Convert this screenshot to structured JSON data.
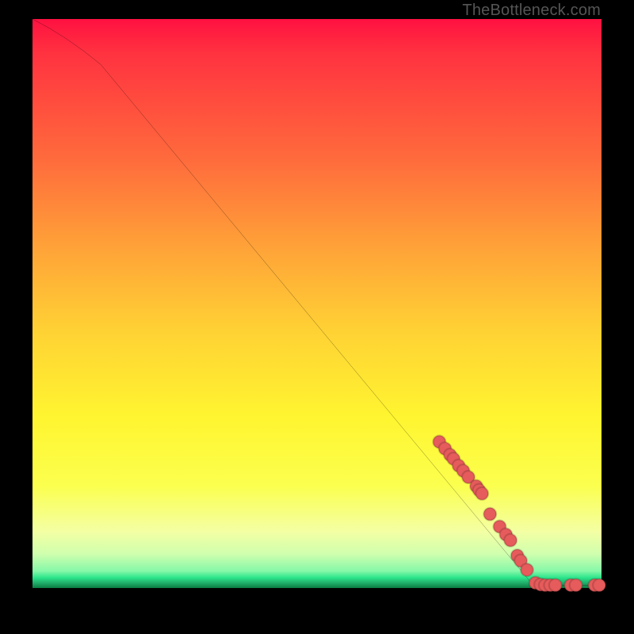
{
  "watermark": "TheBottleneck.com",
  "colors": {
    "background": "#000000",
    "dot": "#e65b5b",
    "curve": "#000000"
  },
  "chart_data": {
    "type": "line",
    "title": "",
    "xlabel": "",
    "ylabel": "",
    "xlim": [
      0,
      100
    ],
    "ylim": [
      0,
      100
    ],
    "grid": false,
    "series": [
      {
        "name": "bottleneck-curve",
        "x": [
          0,
          5,
          12,
          88,
          94,
          100
        ],
        "y": [
          100,
          97,
          92,
          0.5,
          0.5,
          0.5
        ]
      }
    ],
    "points": [
      {
        "x": 71.5,
        "y": 25.7
      },
      {
        "x": 72.5,
        "y": 24.5
      },
      {
        "x": 73.4,
        "y": 23.4
      },
      {
        "x": 74.0,
        "y": 22.7
      },
      {
        "x": 74.9,
        "y": 21.5
      },
      {
        "x": 75.7,
        "y": 20.6
      },
      {
        "x": 76.6,
        "y": 19.5
      },
      {
        "x": 78.0,
        "y": 17.9
      },
      {
        "x": 78.5,
        "y": 17.2
      },
      {
        "x": 79.0,
        "y": 16.6
      },
      {
        "x": 80.4,
        "y": 13.0
      },
      {
        "x": 82.1,
        "y": 10.8
      },
      {
        "x": 83.2,
        "y": 9.4
      },
      {
        "x": 84.0,
        "y": 8.4
      },
      {
        "x": 85.2,
        "y": 5.7
      },
      {
        "x": 85.8,
        "y": 4.8
      },
      {
        "x": 86.9,
        "y": 3.2
      },
      {
        "x": 88.4,
        "y": 0.9
      },
      {
        "x": 89.3,
        "y": 0.6
      },
      {
        "x": 90.1,
        "y": 0.5
      },
      {
        "x": 91.0,
        "y": 0.5
      },
      {
        "x": 91.9,
        "y": 0.5
      },
      {
        "x": 94.6,
        "y": 0.5
      },
      {
        "x": 95.5,
        "y": 0.5
      },
      {
        "x": 98.8,
        "y": 0.5
      },
      {
        "x": 99.6,
        "y": 0.5
      }
    ],
    "point_radius_px": 8
  }
}
